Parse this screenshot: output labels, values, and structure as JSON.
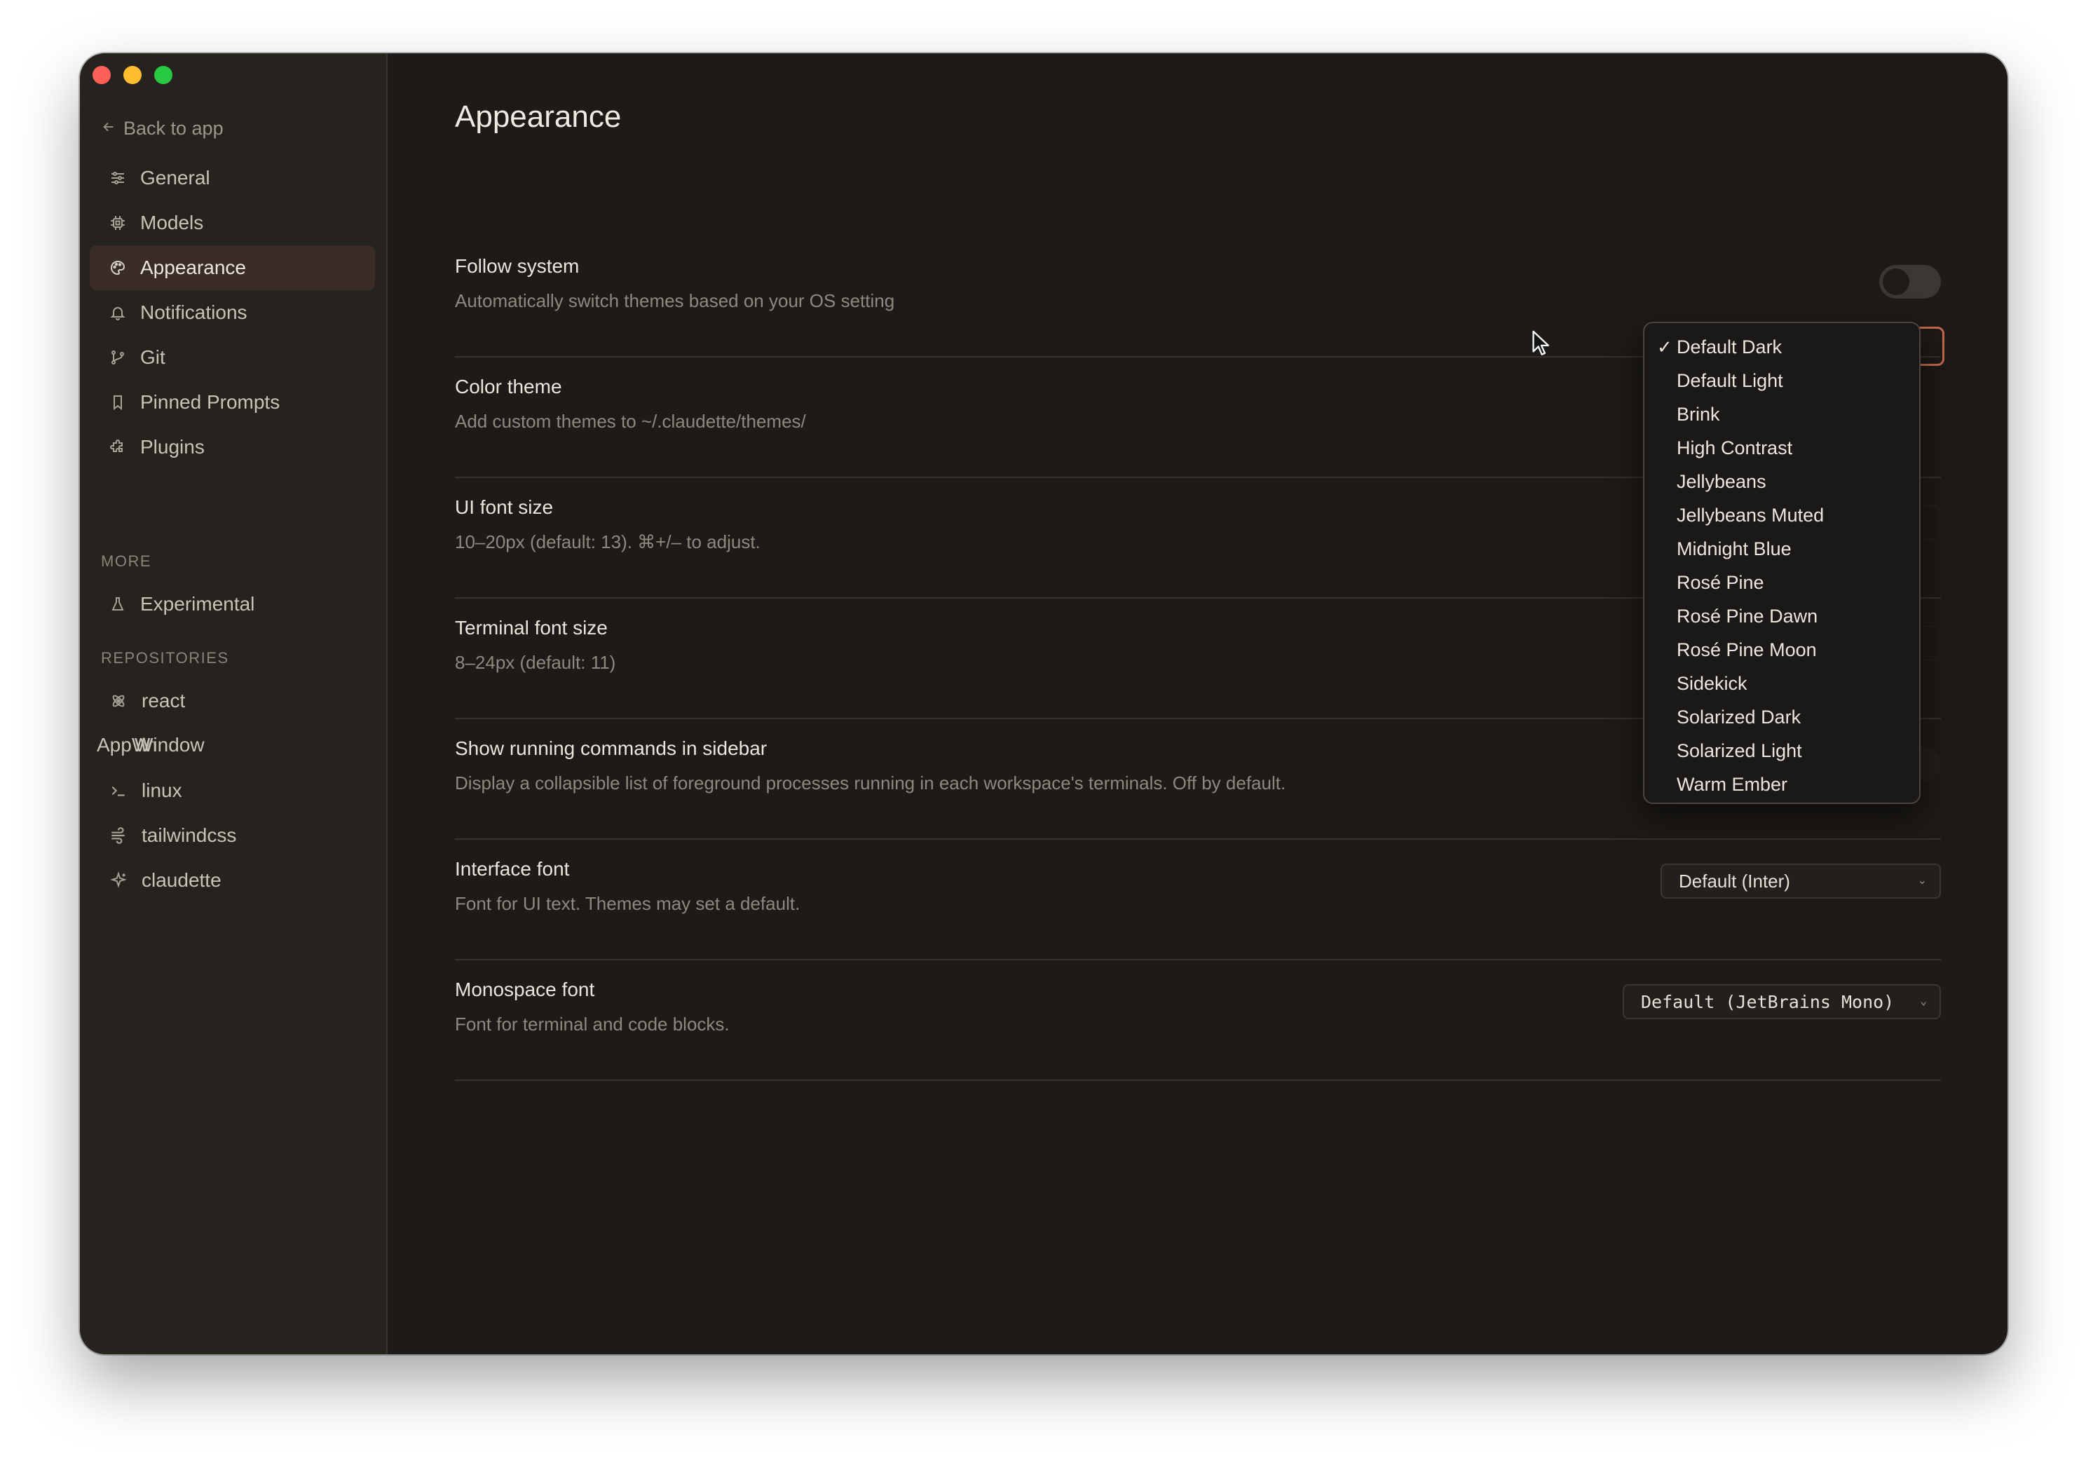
{
  "sidebar": {
    "back_label": "Back to app",
    "items": [
      {
        "label": "General",
        "icon": "sliders-icon"
      },
      {
        "label": "Models",
        "icon": "chip-icon"
      },
      {
        "label": "Appearance",
        "icon": "palette-icon"
      },
      {
        "label": "Notifications",
        "icon": "bell-icon"
      },
      {
        "label": "Git",
        "icon": "git-branch-icon"
      },
      {
        "label": "Pinned Prompts",
        "icon": "bookmark-icon"
      },
      {
        "label": "Plugins",
        "icon": "puzzle-icon"
      }
    ],
    "more_label": "MORE",
    "more_items": [
      {
        "label": "Experimental",
        "icon": "flask-icon"
      }
    ],
    "repositories_label": "REPOSITORIES",
    "repositories": [
      {
        "label": "react",
        "icon": "atom-icon"
      },
      {
        "label_a": "AppW",
        "label_b": "Window",
        "label_overlap": "in"
      },
      {
        "label": "linux",
        "icon": "terminal-icon"
      },
      {
        "label": "tailwindcss",
        "icon": "wind-icon"
      },
      {
        "label": "claudette",
        "icon": "sparkle-icon"
      }
    ]
  },
  "main": {
    "title": "Appearance",
    "settings": {
      "follow_system": {
        "label": "Follow system",
        "desc": "Automatically switch themes based on your OS setting"
      },
      "color_theme": {
        "label": "Color theme",
        "desc": "Add custom themes to ~/.claudette/themes/"
      },
      "ui_font_size": {
        "label": "UI font size",
        "desc": "10–20px (default: 13). ⌘+/– to adjust."
      },
      "terminal_font_size": {
        "label": "Terminal font size",
        "desc": "8–24px (default: 11)"
      },
      "running_commands": {
        "label": "Show running commands in sidebar",
        "desc": "Display a collapsible list of foreground processes running in each workspace's terminals. Off by default."
      },
      "interface_font": {
        "label": "Interface font",
        "desc": "Font for UI text. Themes may set a default.",
        "value": "Default (Inter)"
      },
      "monospace_font": {
        "label": "Monospace font",
        "desc": "Font for terminal and code blocks.",
        "value": "Default (JetBrains Mono)"
      }
    }
  },
  "theme_dropdown": {
    "selected": "Default Dark",
    "check_glyph": "✓",
    "options": [
      "Default Dark",
      "Default Light",
      "Brink",
      "High Contrast",
      "Jellybeans",
      "Jellybeans Muted",
      "Midnight Blue",
      "Rosé Pine",
      "Rosé Pine Dawn",
      "Rosé Pine Moon",
      "Sidekick",
      "Solarized Dark",
      "Solarized Light",
      "Warm Ember"
    ]
  },
  "colors": {
    "window_bg": "#1d1a17",
    "sidebar_bg": "#26231f",
    "active_item_bg": "#3a2d28",
    "accent_border": "#c46a4e",
    "traffic_red": "#fe5f57",
    "traffic_yellow": "#febc2e",
    "traffic_green": "#28c840"
  }
}
